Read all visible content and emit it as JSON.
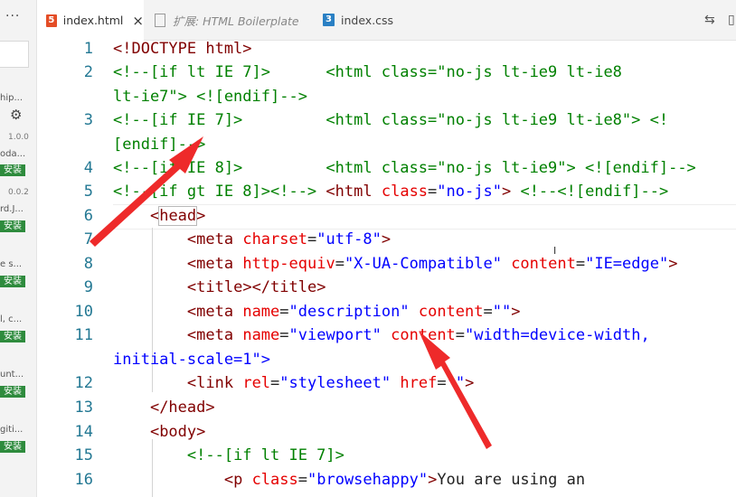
{
  "sidebar": {
    "more_glyph": "···",
    "gear_glyph": "⚙",
    "items": [
      {
        "name": "hip...",
        "version": "",
        "badge": ""
      },
      {
        "name": "oda...",
        "version": "1.0.0",
        "badge": "安装"
      },
      {
        "name": "rd.J...",
        "version": "0.0.2",
        "badge": "安装"
      },
      {
        "name": "e s...",
        "version": "",
        "badge": "安装"
      },
      {
        "name": "l, c...",
        "version": "",
        "badge": "安装"
      },
      {
        "name": "unt...",
        "version": "",
        "badge": "安装"
      },
      {
        "name": "giti...",
        "version": "",
        "badge": "安装"
      }
    ]
  },
  "tabs": [
    {
      "label": "index.html",
      "icon": "html5-icon",
      "active": true,
      "close": "×"
    },
    {
      "label": "扩展: HTML Boilerplate",
      "icon": "file-icon",
      "active": false
    },
    {
      "label": "index.css",
      "icon": "css3-icon",
      "active": false
    }
  ],
  "toolbar": {
    "compare_icon": "⇆",
    "split_icon": "▯"
  },
  "editor": {
    "line_numbers": [
      "1",
      "2",
      "3",
      "4",
      "5",
      "6",
      "7",
      "8",
      "9",
      "10",
      "11",
      "12",
      "13",
      "14",
      "15",
      "16"
    ],
    "lines": [
      "<!DOCTYPE html>",
      "<!--[if lt IE 7]>      <html class=\"no-js lt-ie9 lt-ie8",
      "lt-ie7\"> <![endif]-->",
      "<!--[if IE 7]>         <html class=\"no-js lt-ie9 lt-ie8\"> <!",
      "[endif]-->",
      "<!--[if IE 8]>         <html class=\"no-js lt-ie9\"> <![endif]-->",
      "<!--[if gt IE 8]><!--> <html class=\"no-js\"> <!--<![endif]-->",
      "    <head>",
      "        <meta charset=\"utf-8\">",
      "        <meta http-equiv=\"X-UA-Compatible\" content=\"IE=edge\">",
      "        <title></title>",
      "        <meta name=\"description\" content=\"\">",
      "        <meta name=\"viewport\" content=\"width=device-width,",
      "initial-scale=1\">",
      "        <link rel=\"stylesheet\" href=\"\">",
      "    </head>",
      "    <body>",
      "        <!--[if lt IE 7]>",
      "            <p class=\"browsehappy\">You are using an"
    ]
  }
}
